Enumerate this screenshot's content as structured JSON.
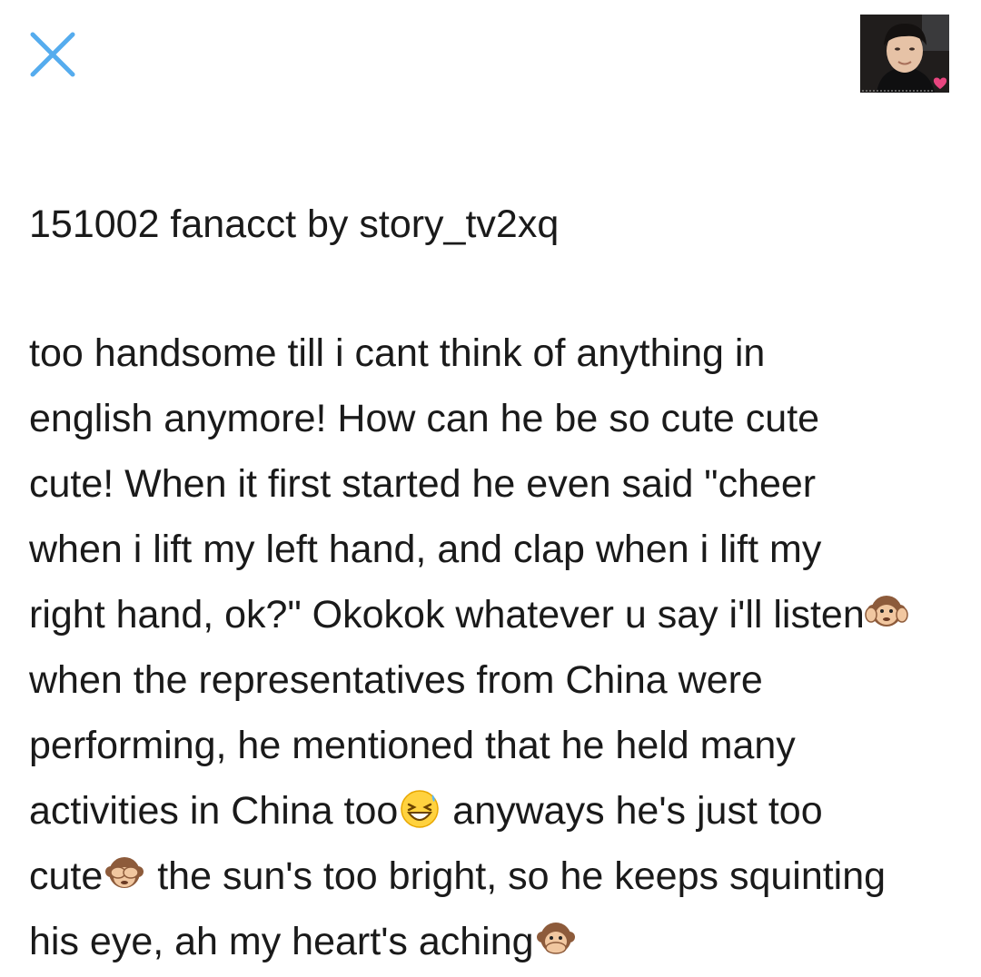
{
  "header": {
    "close_icon": "close-icon",
    "accent_color": "#55acee",
    "avatar_label": "profile-photo"
  },
  "post": {
    "title": "151002 fanacct by story_tv2xq",
    "lines": {
      "l1": "too handsome till i cant think of anything in",
      "l2": "english anymore! How can he be so cute cute",
      "l3": "cute! When it first started he even said \"cheer",
      "l4": "when i lift my left hand, and clap when i lift my",
      "l5": "right hand, ok?\" Okokok whatever u say i'll listen",
      "l6": "when the representatives from China were",
      "l7": "performing, he mentioned that he held many",
      "l8a": "activities in China too",
      "l8b": " anyways he's just too",
      "l9a": "cute",
      "l9b": " the sun's too bright, so he keeps squinting",
      "l10": "his eye, ah my heart's aching"
    },
    "emojis": [
      "hear-no-evil-monkey-icon",
      "laughing-face-icon",
      "see-no-evil-monkey-icon",
      "speak-no-evil-monkey-icon"
    ]
  }
}
